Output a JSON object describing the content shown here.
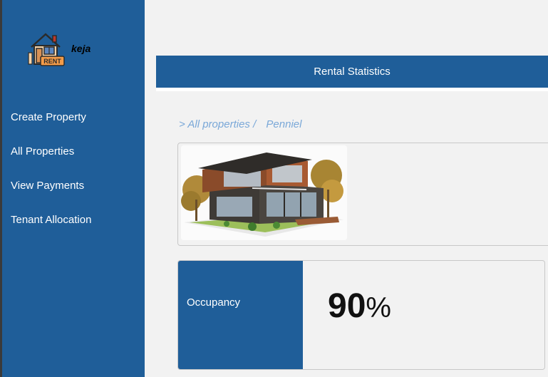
{
  "brand": {
    "name": "keja",
    "logo_text": "RENT",
    "logo_icon": "house-rent-icon"
  },
  "sidebar": {
    "items": [
      {
        "label": "Create Property"
      },
      {
        "label": "All Properties"
      },
      {
        "label": "View Payments"
      },
      {
        "label": "Tenant Allocation"
      }
    ]
  },
  "header": {
    "title": "Rental Statistics"
  },
  "breadcrumb": {
    "parent": "> All properties /",
    "current": "Penniel"
  },
  "property": {
    "image_icon": "modern-house-image"
  },
  "stats": {
    "occupancy_label": "Occupancy",
    "occupancy_value": "90",
    "occupancy_unit": "%"
  },
  "colors": {
    "primary": "#1f5e99",
    "breadcrumb": "#7aa8d8",
    "background": "#f2f2f2"
  }
}
